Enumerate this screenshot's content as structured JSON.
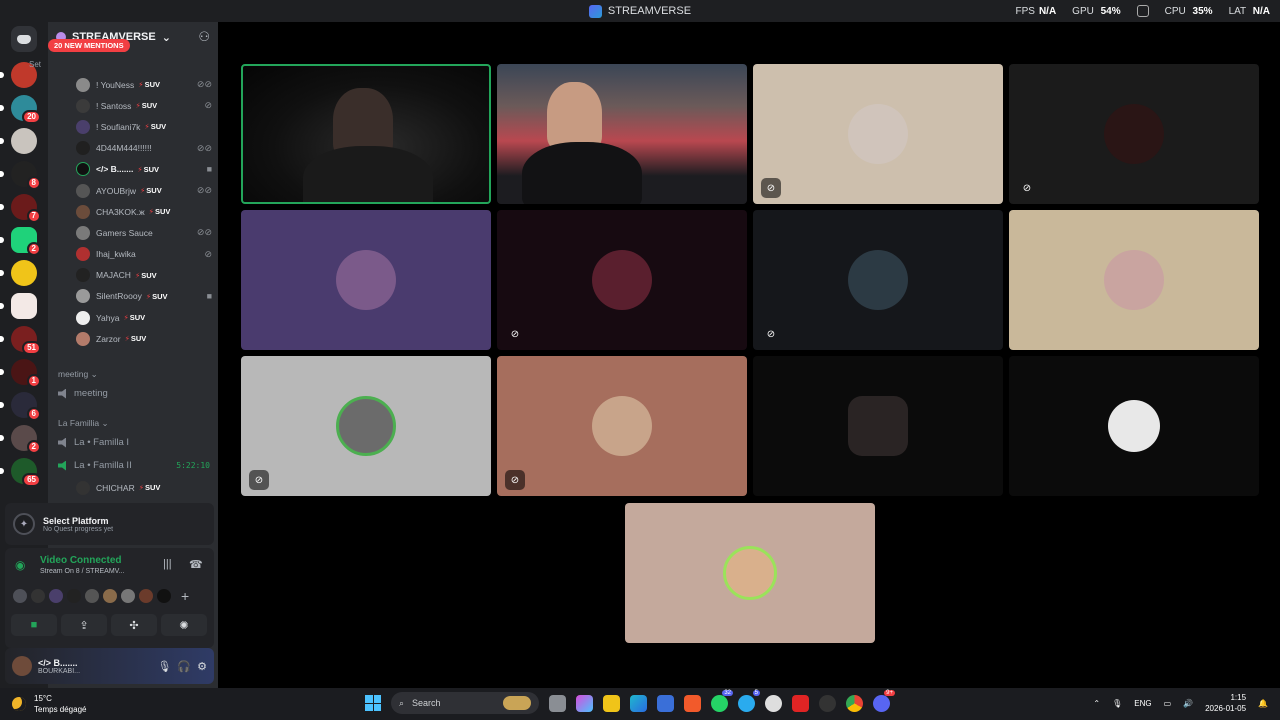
{
  "window": {
    "title": "STREAMVERSE"
  },
  "perf": {
    "fps_label": "FPS",
    "fps": "N/A",
    "gpu_label": "GPU",
    "gpu": "54%",
    "cpu_label": "CPU",
    "cpu": "35%",
    "lat_label": "LAT",
    "lat": "N/A"
  },
  "rail_badges": [
    "20",
    "8",
    "7",
    "2",
    "51",
    "1",
    "6",
    "2",
    "65"
  ],
  "server": {
    "name": "STREAMVERSE",
    "mentions": "20 NEW MENTIONS",
    "set_status": "Set"
  },
  "members": [
    {
      "name": "! YouNess",
      "tag": "SUV",
      "color": "#8a8a8a"
    },
    {
      "name": "! Santoss",
      "tag": "SUV",
      "color": "#3b3b3b"
    },
    {
      "name": "! Soufiani7k",
      "tag": "SUV",
      "color": "#4a3f6b"
    },
    {
      "name": "4D44M444!!!!!!",
      "tag": "",
      "color": "#202020"
    },
    {
      "name": "</> B.......",
      "tag": "SUV",
      "color": "#23a55a"
    },
    {
      "name": "AYOUBrjw",
      "tag": "SUV",
      "color": "#555"
    },
    {
      "name": "CHA3KOK.ж",
      "tag": "SUV",
      "color": "#6b4c3b"
    },
    {
      "name": "Gamers Sauce",
      "tag": "",
      "color": "#7a7a7a"
    },
    {
      "name": "Ihaj_kwika",
      "tag": "",
      "color": "#b03030"
    },
    {
      "name": "MAJACH",
      "tag": "SUV",
      "color": "#222"
    },
    {
      "name": "SilentRoooy",
      "tag": "SUV",
      "color": "#9a9a9a"
    },
    {
      "name": "Yahya",
      "tag": "SUV",
      "color": "#eee"
    },
    {
      "name": "Zarzor",
      "tag": "SUV",
      "color": "#b37b6a"
    }
  ],
  "categories": {
    "meeting": "meeting",
    "famillia": "La Famillia"
  },
  "channels": {
    "meeting": "meeting",
    "famille1": "La • Familla I",
    "famille2": "La • Familla II",
    "famille2_timer": "5:22:10"
  },
  "chichar": {
    "name": "CHICHAR",
    "tag": "SUV"
  },
  "quest": {
    "title": "Select Platform",
    "subtitle": "No Quest progress yet"
  },
  "voice": {
    "status": "Video Connected",
    "stream": "Stream On 8 / STREAMV..."
  },
  "user": {
    "name": "</> B.......",
    "status": "BOURKABI..."
  },
  "tiles": [
    {
      "kind": "cam1"
    },
    {
      "kind": "cam2"
    },
    {
      "bg": "#cdbfad",
      "av": "#d0c4bb"
    },
    {
      "bg": "#1b1b1b",
      "av": "#2a1515"
    },
    {
      "bg": "#4a3b6e",
      "av": "#7b5a8a"
    },
    {
      "bg": "#170a11",
      "av": "#5a1f2e"
    },
    {
      "bg": "#15171b",
      "av": "#2c3a44"
    },
    {
      "bg": "#c9b89a",
      "av": "#c9a4a0"
    },
    {
      "bg": "#b8b8b8",
      "av": "#4caf50"
    },
    {
      "bg": "#a66e5d",
      "av": "#c8a48a"
    },
    {
      "bg": "#0b0b0b",
      "av": "#2a2424"
    },
    {
      "bg": "#0b0b0b",
      "av": "#e8e8e8"
    },
    {
      "bg": "#c4a99c",
      "av": "#d9b08c"
    }
  ],
  "taskbar": {
    "temp": "15°C",
    "weather": "Temps dégagé",
    "search": "Search",
    "lang": "ENG",
    "time": "1:15",
    "date": "2026-01-05",
    "whatsapp_badge": "32",
    "telegram_badge": "5",
    "discord_badge": "9+"
  }
}
